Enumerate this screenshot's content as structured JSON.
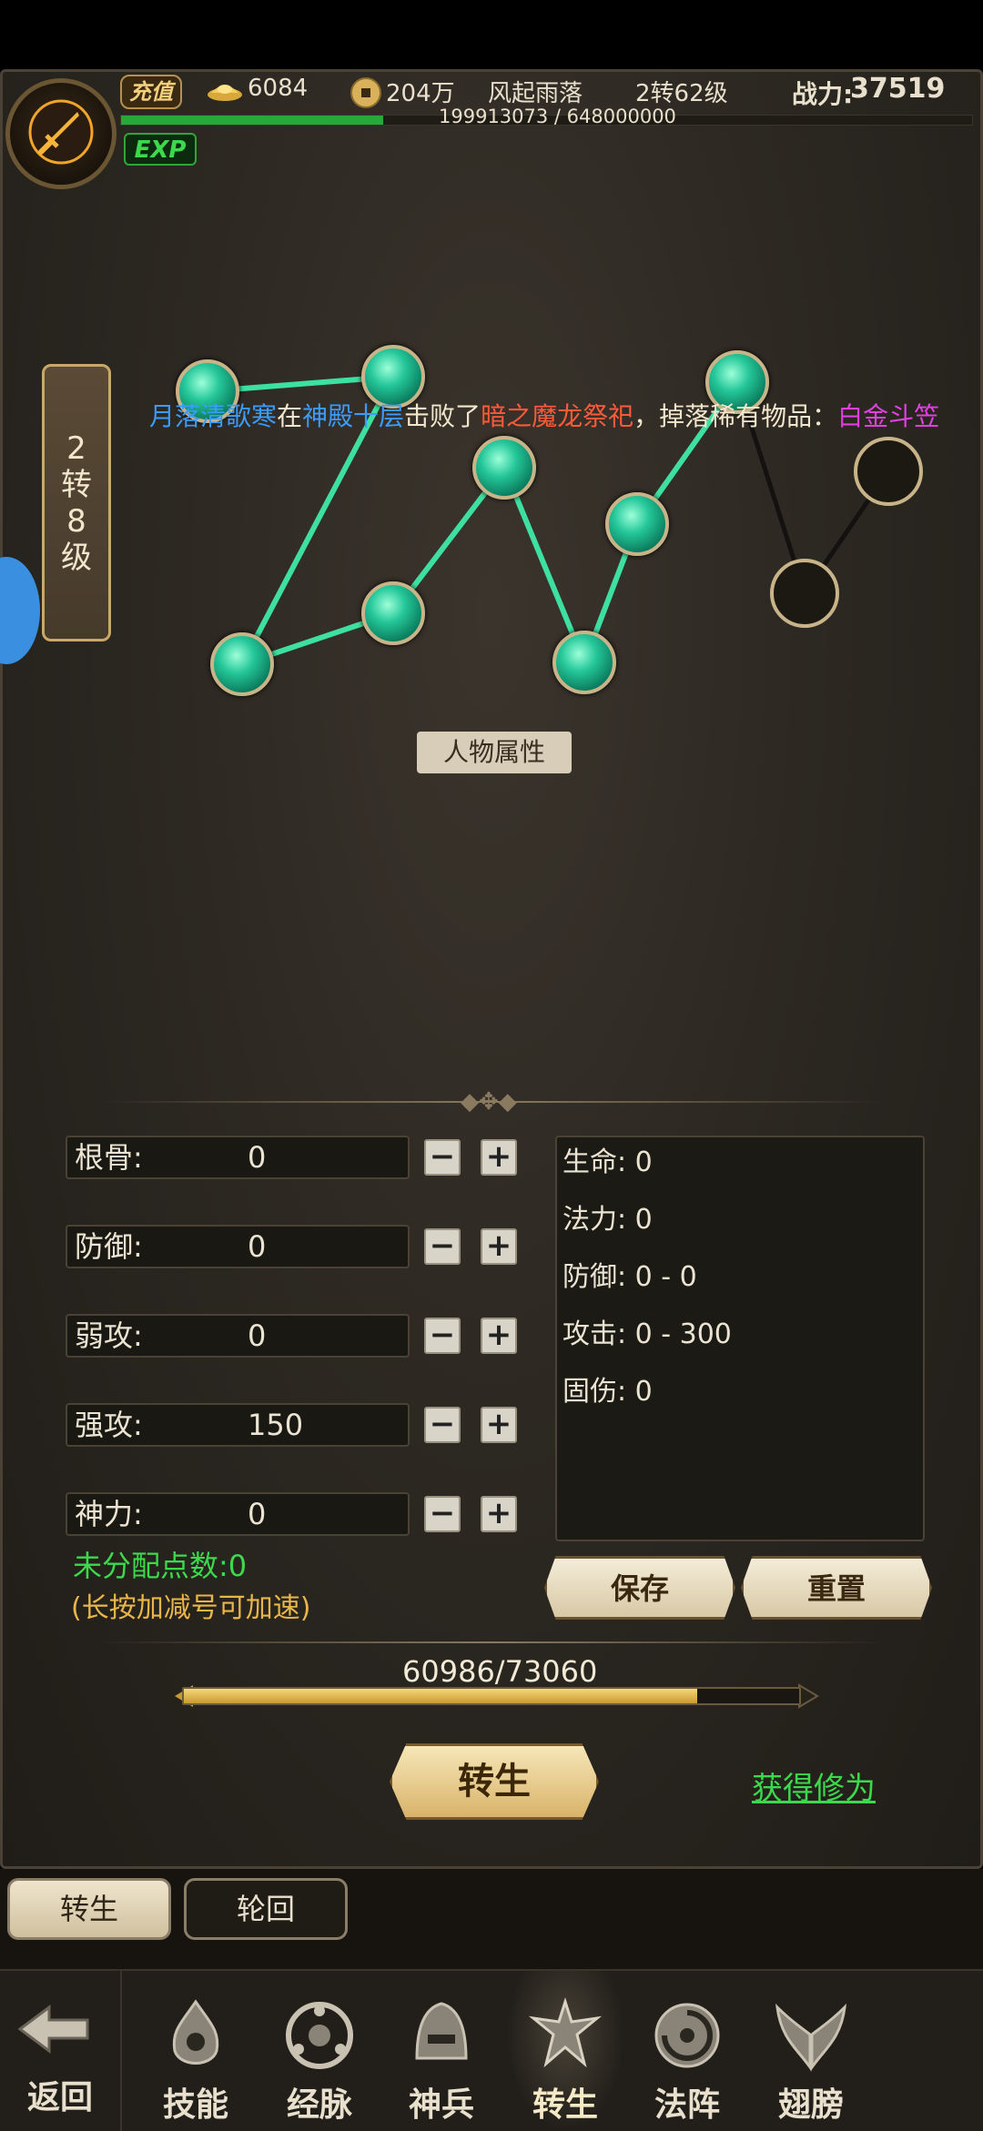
{
  "colors": {
    "accent_gold": "#e9c77a",
    "exp_green": "#27a93a",
    "gem_green": "#25c79a",
    "link_green": "#3bd94b"
  },
  "topbar": {
    "recharge_label": "充值",
    "ingot_icon": "gold-ingot-icon",
    "ingot_count": "6084",
    "coin_icon": "copper-coin-icon",
    "coin_count": "204万",
    "player_name": "风起雨落",
    "level_text": "2转62级",
    "power_label": "战力:",
    "power_value": "37519",
    "exp_badge": "EXP",
    "exp_text": "199913073 / 648000000",
    "exp_progress": 0.308
  },
  "rebirth_badge": [
    "2",
    "转",
    "8",
    "级"
  ],
  "marquee": [
    {
      "text": "月落清歌寒",
      "color": "#3a9cff"
    },
    {
      "text": "在",
      "color": "#f2e6cc"
    },
    {
      "text": "神殿十层",
      "color": "#3a9cff"
    },
    {
      "text": "击败了",
      "color": "#f2e6cc"
    },
    {
      "text": "暗之魔龙祭祀",
      "color": "#ff5a3a"
    },
    {
      "text": "，掉落稀有物品：",
      "color": "#f2e6cc"
    },
    {
      "text": "白金斗笠",
      "color": "#e040e0"
    }
  ],
  "attr_title": "人物属性",
  "stats": [
    {
      "name": "根骨:",
      "value": "0"
    },
    {
      "name": "防御:",
      "value": "0"
    },
    {
      "name": "弱攻:",
      "value": "0"
    },
    {
      "name": "强攻:",
      "value": "150"
    },
    {
      "name": "神力:",
      "value": "0"
    }
  ],
  "minus_glyph": "−",
  "plus_glyph": "+",
  "unallocated": "未分配点数:0",
  "hint": "(长按加减号可加速)",
  "results": [
    "生命: 0",
    "法力: 0",
    "防御: 0 - 0",
    "攻击: 0 - 300",
    "固伤: 0"
  ],
  "save_label": "保存",
  "reset_label": "重置",
  "progress_text": "60986/73060",
  "progress_value": 0.8347,
  "rebirth_button": "转生",
  "gain_link": "获得修为",
  "tabs": [
    {
      "label": "转生",
      "active": true
    },
    {
      "label": "轮回",
      "active": false
    }
  ],
  "back_label": "返回",
  "nav": [
    {
      "label": "技能",
      "icon": "skill-icon"
    },
    {
      "label": "经脉",
      "icon": "meridian-icon"
    },
    {
      "label": "神兵",
      "icon": "divine-weapon-icon"
    },
    {
      "label": "转生",
      "icon": "rebirth-icon",
      "active": true
    },
    {
      "label": "法阵",
      "icon": "array-icon"
    },
    {
      "label": "翅膀",
      "icon": "wings-icon"
    }
  ]
}
